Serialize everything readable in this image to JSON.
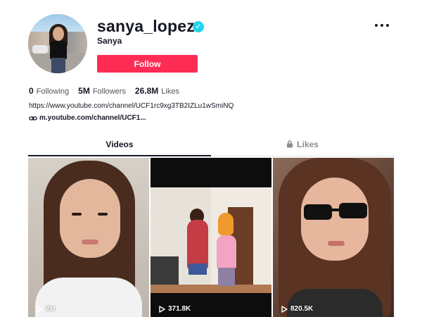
{
  "profile": {
    "username": "sanya_lopez",
    "nickname": "Sanya",
    "verified_icon": "verified-badge-icon",
    "follow_label": "Follow",
    "more_icon": "more-options-icon"
  },
  "stats": [
    {
      "value": "0",
      "label": "Following"
    },
    {
      "value": "5M",
      "label": "Followers"
    },
    {
      "value": "26.8M",
      "label": "Likes"
    }
  ],
  "bio": {
    "text": "https://www.youtube.com/channel/UCF1rc9xg3TB2IZLu1wSmiNQ",
    "link_text": "m.youtube.com/channel/UCF1...",
    "link_icon": "link-icon"
  },
  "tabs": {
    "videos_label": "Videos",
    "likes_label": "Likes",
    "likes_icon": "lock-icon"
  },
  "videos": [
    {
      "views": "2M"
    },
    {
      "views": "371.8K"
    },
    {
      "views": "820.5K"
    }
  ],
  "colors": {
    "accent": "#fe2c55",
    "verified": "#20d5ec",
    "text_primary": "#161823",
    "text_muted": "#8a8b91"
  }
}
